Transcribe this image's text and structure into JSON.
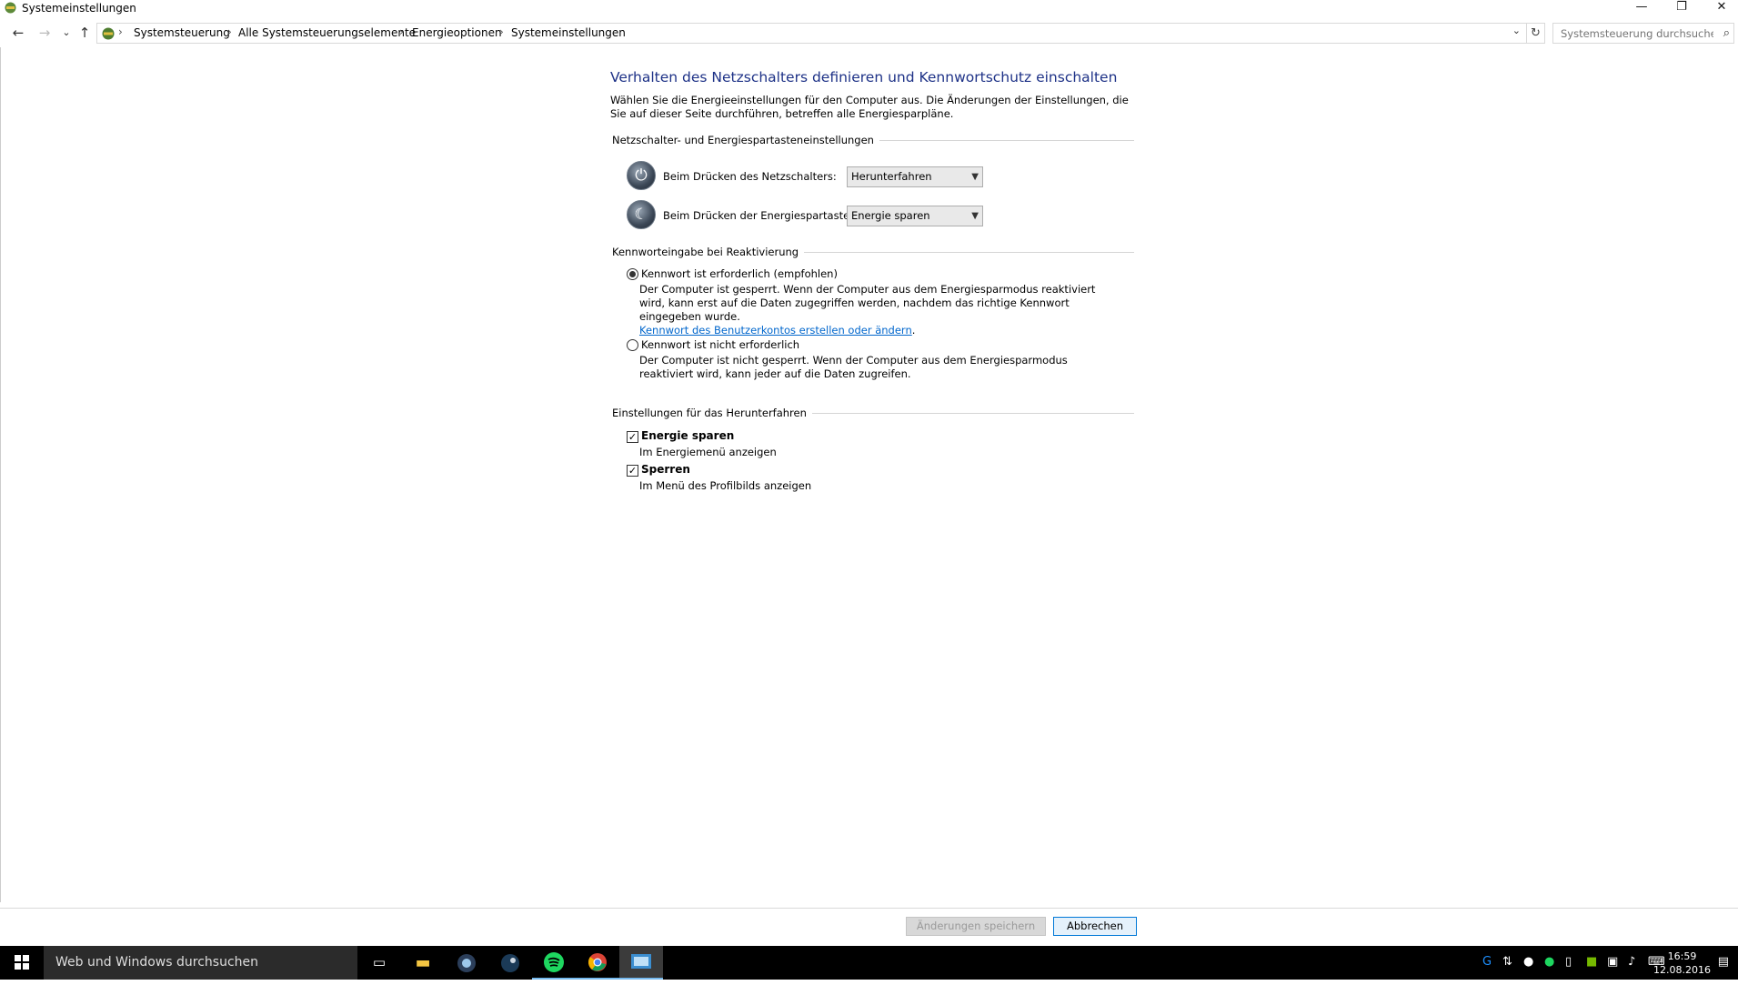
{
  "window": {
    "title": "Systemeinstellungen",
    "minimize": "—",
    "restore": "❐",
    "close": "✕"
  },
  "nav": {
    "back": "←",
    "forward": "→",
    "recent": "⌄",
    "up": "↑",
    "refresh": "↻"
  },
  "breadcrumb": [
    "Systemsteuerung",
    "Alle Systemsteuerungselemente",
    "Energieoptionen",
    "Systemeinstellungen"
  ],
  "breadcrumb_separator": "›",
  "search": {
    "placeholder": "Systemsteuerung durchsuchen",
    "icon": "search-icon"
  },
  "main": {
    "heading": "Verhalten des Netzschalters definieren und Kennwortschutz einschalten",
    "intro": "Wählen Sie die Energieeinstellungen für den Computer aus. Die Änderungen der Einstellungen, die Sie auf dieser Seite durchführen, betreffen alle Energiesparpläne.",
    "power_section": {
      "title": "Netzschalter- und Energiespartasteneinstellungen",
      "rows": [
        {
          "label": "Beim Drücken des Netzschalters:",
          "value": "Herunterfahren",
          "icon": "power-icon"
        },
        {
          "label": "Beim Drücken der Energiespartaste:",
          "value": "Energie sparen",
          "icon": "sleep-icon"
        }
      ]
    },
    "password_section": {
      "title": "Kennworteingabe bei Reaktivierung",
      "options": [
        {
          "label": "Kennwort ist erforderlich (empfohlen)",
          "selected": true,
          "description": "Der Computer ist gesperrt. Wenn der Computer aus dem Energiesparmodus reaktiviert wird, kann erst auf die Daten zugegriffen werden, nachdem das richtige Kennwort eingegeben wurde.",
          "link": "Kennwort des Benutzerkontos erstellen oder ändern",
          "link_suffix": "."
        },
        {
          "label": "Kennwort ist nicht erforderlich",
          "selected": false,
          "description": "Der Computer ist nicht gesperrt. Wenn der Computer aus dem Energiesparmodus reaktiviert wird, kann jeder auf die Daten zugreifen."
        }
      ]
    },
    "shutdown_section": {
      "title": "Einstellungen für das Herunterfahren",
      "items": [
        {
          "label": "Energie sparen",
          "checked": true,
          "description": "Im Energiemenü anzeigen"
        },
        {
          "label": "Sperren",
          "checked": true,
          "description": "Im Menü des Profilbilds anzeigen"
        }
      ]
    }
  },
  "footer": {
    "save_label": "Änderungen speichern",
    "save_enabled": false,
    "cancel_label": "Abbrechen"
  },
  "taskbar": {
    "search_placeholder": "Web und Windows durchsuchen",
    "apps": [
      "task-view-icon",
      "file-explorer-icon",
      "teamspeak-icon",
      "steam-icon",
      "spotify-icon",
      "chrome-icon",
      "control-panel-icon"
    ],
    "time": "16:59",
    "date": "12.08.2016"
  },
  "colors": {
    "heading": "#1e3287",
    "link": "#0066cc",
    "taskbar": "#000000",
    "taskbar_search": "#2b2b2b"
  }
}
